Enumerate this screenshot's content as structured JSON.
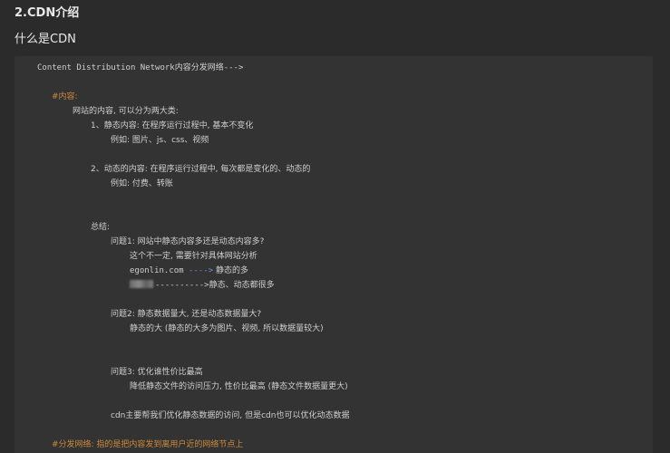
{
  "heading": "2.CDN介绍",
  "subheading": "什么是CDN",
  "code": {
    "intro": "Content Distribution Network内容分发网络--->",
    "content_tag": "#内容:",
    "site_content": "网站的内容, 可以分为两大类:",
    "static_item": "1、静态内容: 在程序运行过程中, 基本不变化",
    "static_example": "例如: 图片、js、css、视频",
    "dynamic_item": "2、动态的内容: 在程序运行过程中, 每次都是变化的、动态的",
    "dynamic_example": "例如: 付费、转账",
    "summary": "总结:",
    "q1": "问题1: 网站中静态内容多还是动态内容多?",
    "q1_a1": "这个不一定, 需要针对具体网站分析",
    "q1_a2_site": "egonlin.com",
    "q1_a2_arrow": " ---->",
    "q1_a2_rest": " 静态的多",
    "q1_a3_arrow": "---------->",
    "q1_a3_rest": "静态、动态都很多",
    "q2": "问题2: 静态数据量大, 还是动态数据量大?",
    "q2_a": "静态的大 (静态的大多为图片、视频, 所以数据量较大)",
    "q3": "问题3: 优化谁性价比最高",
    "q3_a": "降低静态文件的访问压力, 性价比最高 (静态文件数据量更大)",
    "cdn_note": "cdn主要帮我们优化静态数据的访问, 但是cdn也可以优化动态数据",
    "distribution_tag": "#分发网络: 指的是把内容发到离用户近的网络节点上"
  }
}
